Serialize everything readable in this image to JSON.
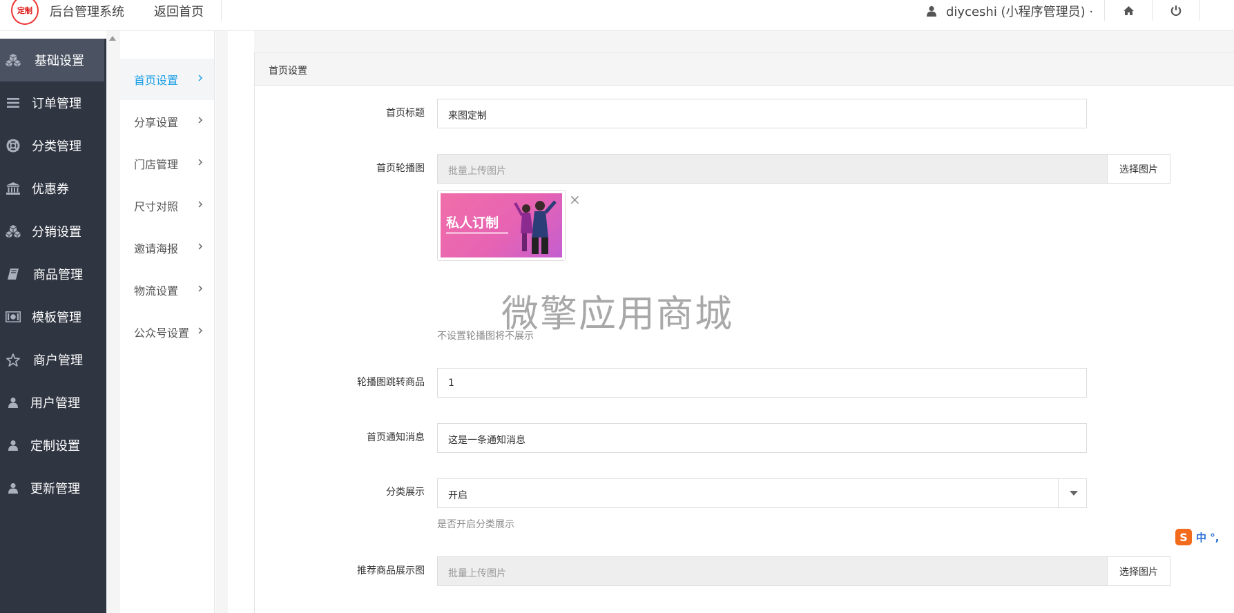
{
  "header": {
    "logo_text": "定制",
    "app_title": "后台管理系统",
    "back_home": "返回首页",
    "user_label": "diyceshi (小程序管理员) ·"
  },
  "sidebar": {
    "items": [
      {
        "label": "基础设置",
        "icon": "cubes-icon"
      },
      {
        "label": "订单管理",
        "icon": "list-icon"
      },
      {
        "label": "分类管理",
        "icon": "lifebuoy-icon"
      },
      {
        "label": "优惠券",
        "icon": "bank-icon"
      },
      {
        "label": "分销设置",
        "icon": "cubes-icon"
      },
      {
        "label": "商品管理",
        "icon": "book-icon"
      },
      {
        "label": "模板管理",
        "icon": "money-icon"
      },
      {
        "label": "商户管理",
        "icon": "star-icon"
      },
      {
        "label": "用户管理",
        "icon": "user-icon"
      },
      {
        "label": "定制设置",
        "icon": "user-icon"
      },
      {
        "label": "更新管理",
        "icon": "user-icon"
      }
    ]
  },
  "subnav": {
    "items": [
      {
        "label": "首页设置"
      },
      {
        "label": "分享设置"
      },
      {
        "label": "门店管理"
      },
      {
        "label": "尺寸对照"
      },
      {
        "label": "邀请海报"
      },
      {
        "label": "物流设置"
      },
      {
        "label": "公众号设置"
      }
    ]
  },
  "panel": {
    "title": "首页设置",
    "home_title_label": "首页标题",
    "home_title_value": "来图定制",
    "banner_label": "首页轮播图",
    "banner_placeholder": "批量上传图片",
    "pick_image": "选择图片",
    "banner_image_text": "私人订制",
    "banner_hint": "不设置轮播图将不展示",
    "jump_label": "轮播图跳转商品",
    "jump_value": "1",
    "notice_label": "首页通知消息",
    "notice_value": "这是一条通知消息",
    "category_label": "分类展示",
    "category_value": "开启",
    "category_hint": "是否开启分类展示",
    "recommend_label": "推荐商品展示图",
    "recommend_placeholder": "批量上传图片",
    "recommend_pick": "选择图片"
  },
  "watermark": "微擎应用商城",
  "ime": {
    "badge": "S",
    "text": "中 °,"
  },
  "colors": {
    "sidebar_bg": "#2f3541",
    "sidebar_active": "#4b5363",
    "accent": "#1e9fe7"
  }
}
